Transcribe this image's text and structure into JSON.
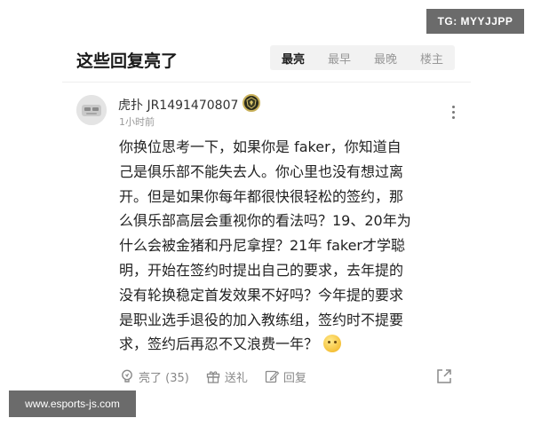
{
  "watermarks": {
    "top_right": "TG: MYYJJPP",
    "bottom_left": "www.esports-js.com"
  },
  "section": {
    "title": "这些回复亮了",
    "sort_tabs": [
      {
        "label": "最亮",
        "active": true
      },
      {
        "label": "最早",
        "active": false
      },
      {
        "label": "最晚",
        "active": false
      },
      {
        "label": "楼主",
        "active": false
      }
    ]
  },
  "comment": {
    "username": "虎扑 JR1491470807",
    "timestamp": "1小时前",
    "icons": {
      "avatar": "user-avatar",
      "badge": "team-badge-icon",
      "more": "more-vertical-icon"
    },
    "body_lines": [
      "你换位思考一下，如果你是 faker，你知道自",
      "己是俱乐部不能失去人。你心里也没有想过离",
      "开。但是如果你每年都很快很轻松的签约，那",
      "么俱乐部高层会重视你的看法吗？19、20年为",
      "什么会被金猪和丹尼拿捏？21年 faker才学聪",
      "明，开始在签约时提出自己的要求，去年提的",
      "没有轮换稳定首发效果不好吗？今年提的要求",
      "是职业选手退役的加入教练组，签约时不提要",
      "求，签约后再忍不又浪费一年？"
    ],
    "actions": {
      "like_label": "亮了 (35)",
      "gift_label": "送礼",
      "reply_label": "回复"
    }
  },
  "colors": {
    "text_primary": "#222222",
    "text_muted": "#999999",
    "tab_background": "#f2f2f2",
    "watermark_background": "#6b6b6b"
  }
}
